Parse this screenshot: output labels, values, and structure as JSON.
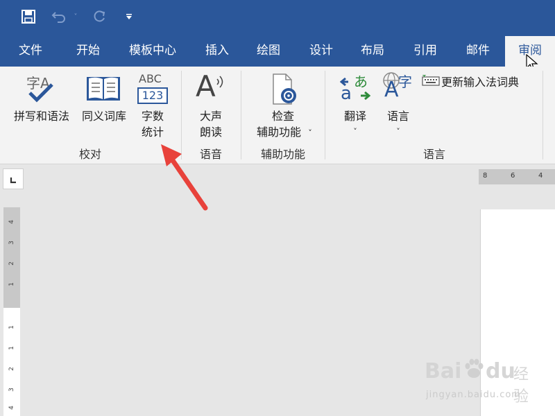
{
  "quick_access": {
    "save_icon": "save-icon",
    "undo_icon": "undo-icon",
    "redo_icon": "redo-icon",
    "customize_icon": "customize-qat-icon"
  },
  "tabs": [
    {
      "label": "文件"
    },
    {
      "label": "开始"
    },
    {
      "label": "模板中心"
    },
    {
      "label": "插入"
    },
    {
      "label": "绘图"
    },
    {
      "label": "设计"
    },
    {
      "label": "布局"
    },
    {
      "label": "引用"
    },
    {
      "label": "邮件"
    },
    {
      "label": "审阅",
      "active": true
    }
  ],
  "ribbon": {
    "groups": {
      "proofing": {
        "label": "校对",
        "spelling": {
          "label": "拼写和语法",
          "icon_text": "字A"
        },
        "thesaurus": {
          "label": "同义词库"
        },
        "word_count": {
          "line1": "字数",
          "line2": "统计",
          "icon_text_top": "ABC",
          "icon_text_bottom": "123"
        }
      },
      "speech": {
        "label": "语音",
        "read_aloud": {
          "line1": "大声",
          "line2": "朗读",
          "icon_text": "A"
        }
      },
      "accessibility": {
        "label": "辅助功能",
        "check": {
          "line1": "检查",
          "line2": "辅助功能",
          "caret": "˅"
        }
      },
      "language": {
        "label": "语言",
        "translate": {
          "label": "翻译",
          "caret": "˅",
          "icon_top": "あ",
          "icon_bottom": "a"
        },
        "language": {
          "label": "语言",
          "caret": "˅",
          "icon_text": "A",
          "icon_sub": "字"
        },
        "update_ime": {
          "label": "更新输入法词典"
        }
      }
    }
  },
  "ruler": {
    "horizontal": [
      "8",
      "6",
      "4"
    ],
    "vertical": [
      "4",
      "3",
      "2",
      "1",
      "1",
      "1",
      "2",
      "3",
      "4"
    ]
  },
  "watermark": {
    "brand": "Bai",
    "brand2": "du",
    "cn": "经验",
    "url": "jingyan.baidu.com"
  },
  "colors": {
    "accent": "#2b579a",
    "arrow": "#e8423b",
    "check": "#2b579a"
  }
}
